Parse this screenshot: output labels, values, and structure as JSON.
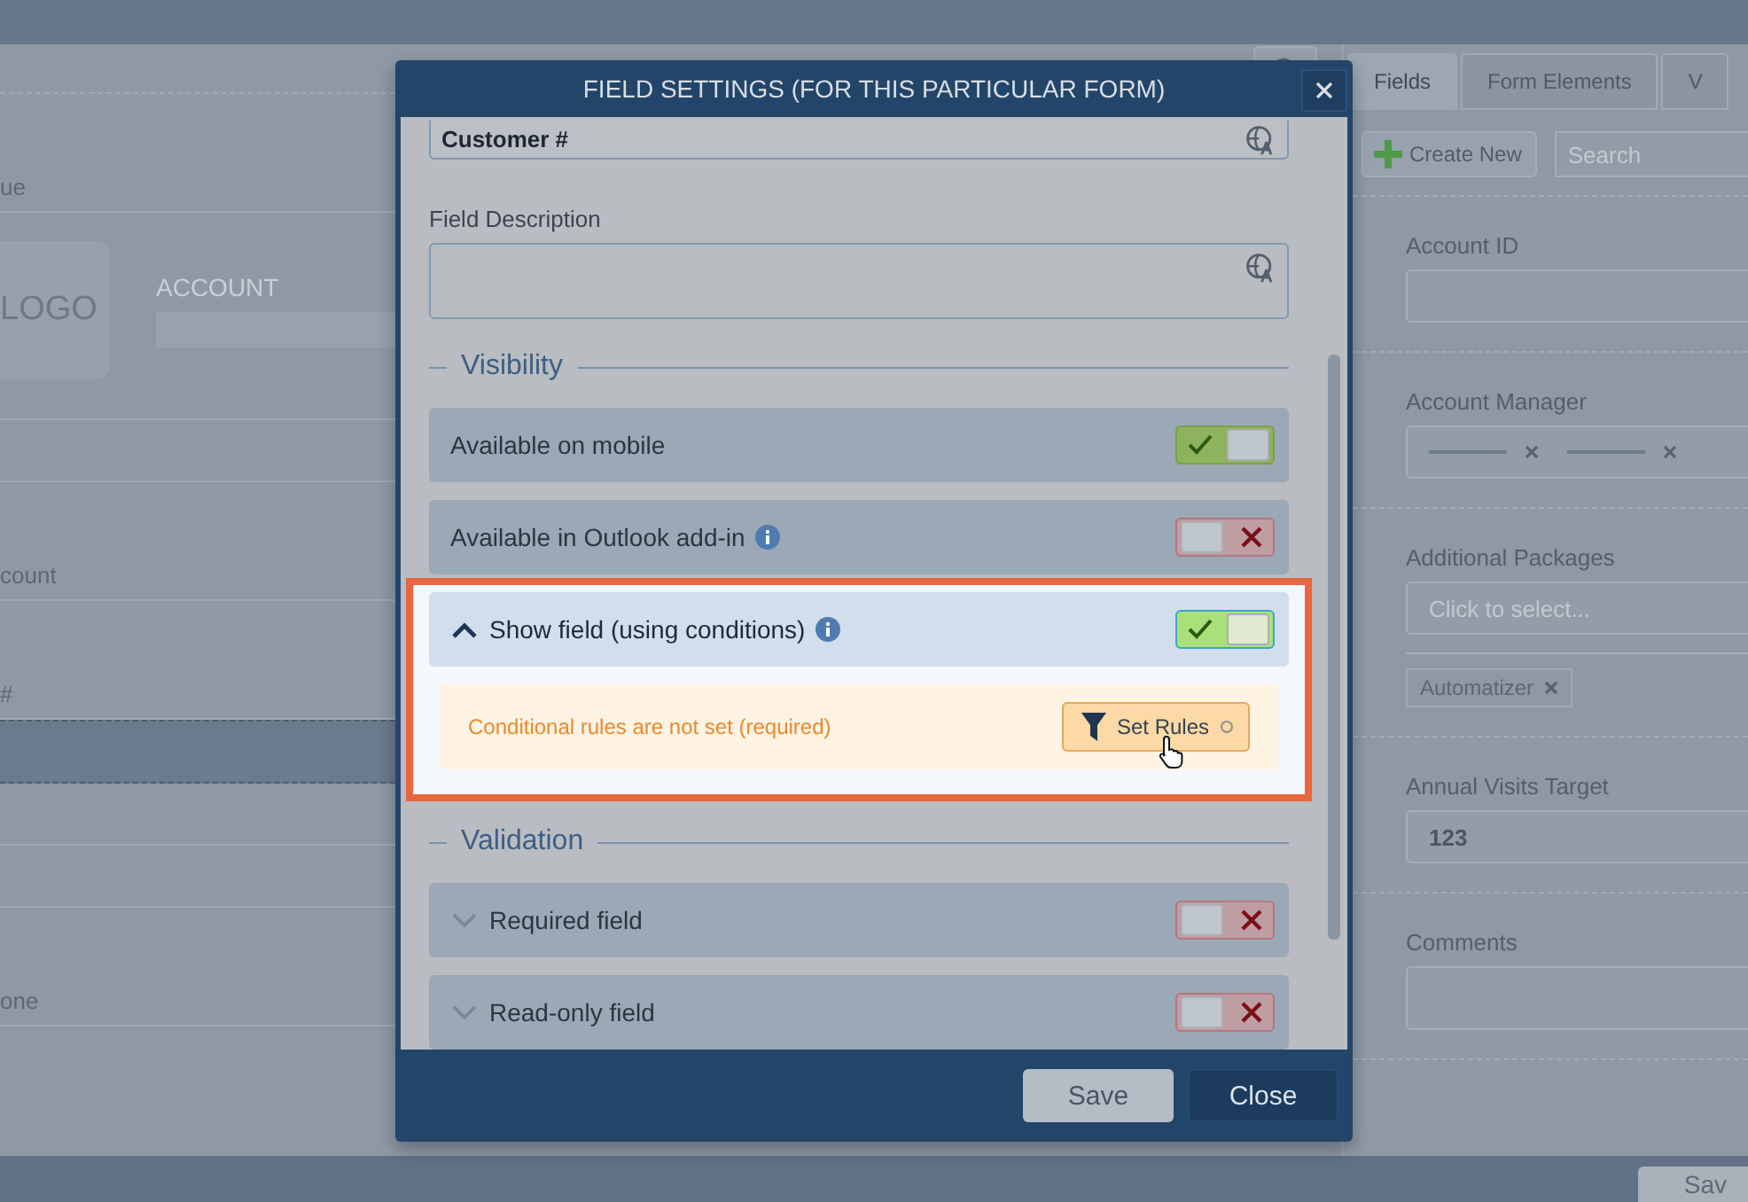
{
  "form_canvas": {
    "rows": [
      {
        "kind": "label",
        "text": "ue",
        "selected": false
      },
      {
        "kind": "logo",
        "logo_text": "LOGO",
        "caption": "ACCOUNT",
        "selected": false
      },
      {
        "kind": "blank",
        "selected": false
      },
      {
        "kind": "label",
        "text": "count",
        "selected": false
      },
      {
        "kind": "label",
        "text": "#",
        "selected": false
      },
      {
        "kind": "blank",
        "selected": true
      },
      {
        "kind": "blank",
        "selected": false
      },
      {
        "kind": "blank",
        "selected": false
      },
      {
        "kind": "label",
        "text": "one",
        "selected": false
      }
    ]
  },
  "side_panel": {
    "tabs": [
      {
        "label": "Fields",
        "selected": true
      },
      {
        "label": "Form Elements",
        "selected": false
      },
      {
        "label": "V",
        "selected": false
      }
    ],
    "create_button": "Create New",
    "search": {
      "placeholder": "Search"
    },
    "fields": [
      {
        "kind": "text",
        "label": "Account ID"
      },
      {
        "kind": "users",
        "label": "Account Manager"
      },
      {
        "kind": "multiselect",
        "label": "Additional Packages",
        "placeholder": "Click to select...",
        "tags": [
          "Automatizer"
        ]
      },
      {
        "kind": "text",
        "label": "Annual Visits Target",
        "value": "123"
      },
      {
        "kind": "textarea",
        "label": "Comments"
      }
    ],
    "save_button": "Sav"
  },
  "dialog": {
    "title": "FIELD SETTINGS (FOR THIS PARTICULAR FORM)",
    "name_field": {
      "value": "Customer #"
    },
    "description": {
      "label": "Field Description"
    },
    "sections": [
      {
        "title": "Visibility",
        "rows": [
          {
            "label": "Available on mobile",
            "kind": "plain",
            "info": false,
            "on": true,
            "highlighted": false
          },
          {
            "label": "Available in Outlook add-in",
            "kind": "plain",
            "info": true,
            "on": false,
            "highlighted": false
          },
          {
            "label": "Show field (using conditions)",
            "kind": "expandable",
            "expanded": true,
            "info": true,
            "on": true,
            "highlighted": true,
            "notice": "Conditional rules are not set (required)",
            "action": "Set Rules"
          }
        ]
      },
      {
        "title": "Validation",
        "rows": [
          {
            "label": "Required field",
            "kind": "expandable",
            "expanded": false,
            "info": false,
            "on": false,
            "highlighted": false
          },
          {
            "label": "Read-only field",
            "kind": "expandable",
            "expanded": false,
            "info": false,
            "on": false,
            "highlighted": false
          }
        ]
      }
    ],
    "buttons": [
      {
        "label": "Save",
        "kind": "secondary"
      },
      {
        "label": "Close",
        "kind": "primary"
      }
    ]
  }
}
